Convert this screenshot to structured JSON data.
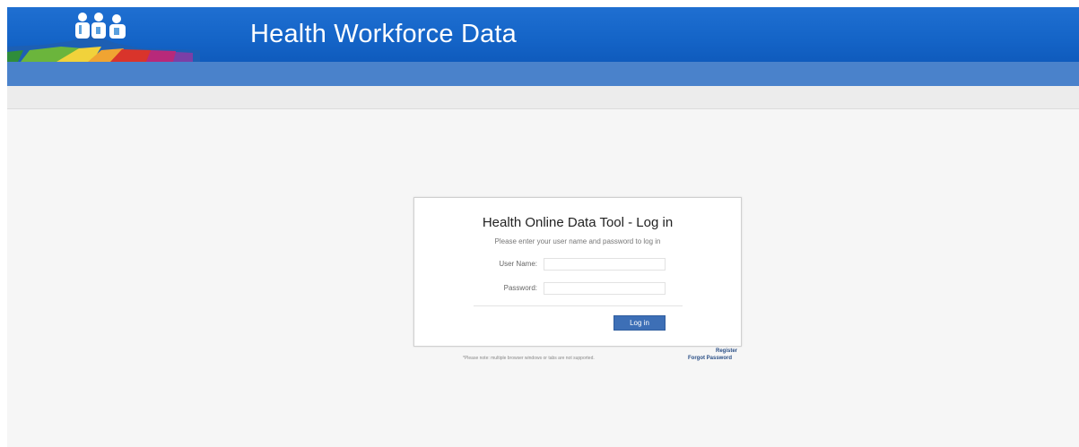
{
  "header": {
    "title": "Health Workforce Data",
    "logo_icon": "health-workers-logo-icon"
  },
  "login": {
    "title": "Health Online Data Tool - Log in",
    "subtitle": "Please enter your user name and password to log in",
    "username_label": "User Name:",
    "username_value": "",
    "password_label": "Password:",
    "password_value": "",
    "login_button": "Log in"
  },
  "footer": {
    "note": "*Please note: multiple browser windows or tabs are not supported.",
    "register_link": "Register",
    "forgot_link": "Forgot Password"
  },
  "colors": {
    "header_blue": "#1565c8",
    "subbar_blue": "#4a82cb",
    "button_blue": "#3d6fb6",
    "page_bg": "#f6f6f6"
  }
}
